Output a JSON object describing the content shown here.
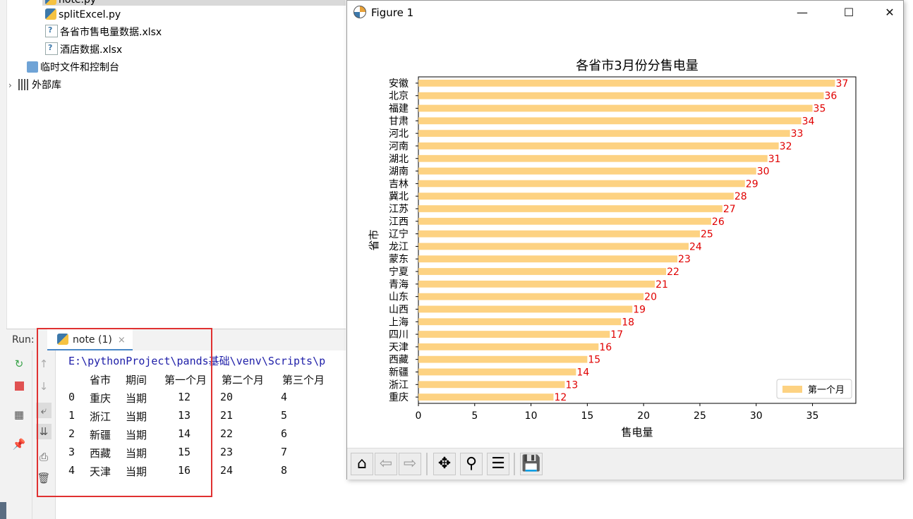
{
  "project_tree": {
    "items": [
      {
        "label": "note.py",
        "icon": "python-file-icon"
      },
      {
        "label": "splitExcel.py",
        "icon": "python-file-icon"
      },
      {
        "label": "各省市售电量数据.xlsx",
        "icon": "excel-file-icon"
      },
      {
        "label": "酒店数据.xlsx",
        "icon": "excel-file-icon"
      },
      {
        "label": "临时文件和控制台",
        "icon": "scratches-icon"
      },
      {
        "label": "外部库",
        "icon": "library-icon"
      }
    ]
  },
  "run_panel": {
    "label": "Run:",
    "tab_label": "note (1)",
    "tab_close": "×",
    "command": "E:\\pythonProject\\pands基础\\venv\\Scripts\\p",
    "table": {
      "headers": [
        "省市",
        "期间",
        "第一个月",
        "第二个月",
        "第三个月"
      ],
      "rows": [
        {
          "index": "0",
          "cells": [
            "重庆",
            "当期",
            "12",
            "20",
            "4"
          ]
        },
        {
          "index": "1",
          "cells": [
            "浙江",
            "当期",
            "13",
            "21",
            "5"
          ]
        },
        {
          "index": "2",
          "cells": [
            "新疆",
            "当期",
            "14",
            "22",
            "6"
          ]
        },
        {
          "index": "3",
          "cells": [
            "西藏",
            "当期",
            "15",
            "23",
            "7"
          ]
        },
        {
          "index": "4",
          "cells": [
            "天津",
            "当期",
            "16",
            "24",
            "8"
          ]
        }
      ]
    },
    "highlight_color": "#e03131"
  },
  "figure_window": {
    "title": "Figure 1",
    "minimize": "—",
    "maximize": "☐",
    "close": "✕",
    "toolbar": [
      "home-icon",
      "back-icon",
      "forward-icon",
      "pan-icon",
      "zoom-icon",
      "configure-subplots-icon",
      "save-icon"
    ]
  },
  "chart_data": {
    "type": "bar",
    "orientation": "horizontal",
    "title": "各省市3月份分售电量",
    "xlabel": "售电量",
    "ylabel": "省市",
    "categories": [
      "安徽",
      "北京",
      "福建",
      "甘肃",
      "河北",
      "河南",
      "湖北",
      "湖南",
      "吉林",
      "冀北",
      "江苏",
      "江西",
      "辽宁",
      "龙江",
      "蒙东",
      "宁夏",
      "青海",
      "山东",
      "山西",
      "上海",
      "四川",
      "天津",
      "西藏",
      "新疆",
      "浙江",
      "重庆"
    ],
    "series": [
      {
        "name": "第一个月",
        "values": [
          37,
          36,
          35,
          34,
          33,
          32,
          31,
          30,
          29,
          28,
          27,
          26,
          25,
          24,
          23,
          22,
          21,
          20,
          19,
          18,
          17,
          16,
          15,
          14,
          13,
          12
        ],
        "color": "#fdd282"
      }
    ],
    "value_label_color": "#e00000",
    "xlim": [
      0,
      38.85
    ],
    "xticks": [
      0,
      5,
      10,
      15,
      20,
      25,
      30,
      35
    ],
    "grid": false,
    "legend_position": "lower right"
  }
}
